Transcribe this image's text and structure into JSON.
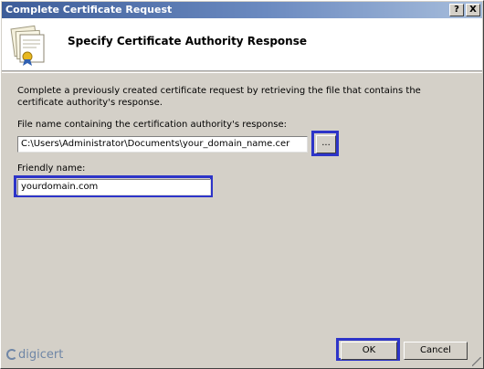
{
  "window": {
    "title": "Complete Certificate Request",
    "help_label": "?",
    "close_label": "X"
  },
  "header": {
    "title": "Specify Certificate Authority Response",
    "icon": "certificate-icon"
  },
  "form": {
    "description": "Complete a previously created certificate request by retrieving the file that contains the certificate authority's response.",
    "file_label": "File name containing the certification authority's response:",
    "file_value": "C:\\Users\\Administrator\\Documents\\your_domain_name.cer",
    "browse_label": "...",
    "friendly_label": "Friendly name:",
    "friendly_value": "yourdomain.com"
  },
  "buttons": {
    "ok_label": "OK",
    "cancel_label": "Cancel"
  },
  "branding": {
    "logo_text": "digicert"
  },
  "colors": {
    "highlight": "#2d34c8",
    "titlebar": "#3d5d99"
  }
}
